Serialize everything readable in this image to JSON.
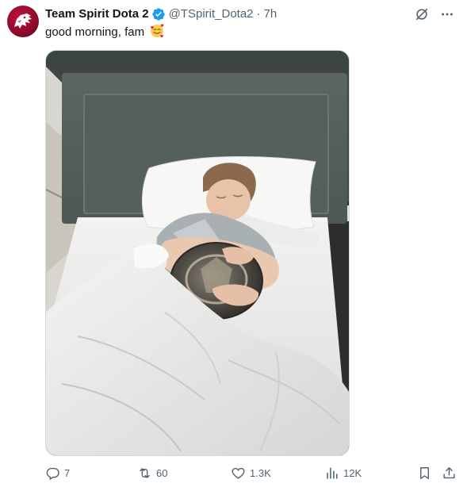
{
  "tweet": {
    "display_name": "Team Spirit Dota 2",
    "handle": "@TSpirit_Dota2",
    "separator": "·",
    "time": "7h",
    "text": "good morning, fam",
    "emoji": "smiling-face-with-hearts"
  },
  "media": {
    "kind": "photo"
  },
  "actions": {
    "replies": "7",
    "reposts": "60",
    "likes": "1.3K",
    "views": "12K"
  },
  "colors": {
    "text": "#0f1419",
    "secondary": "#536471",
    "verified": "#1d9bf0",
    "brand": "#a30e33"
  }
}
